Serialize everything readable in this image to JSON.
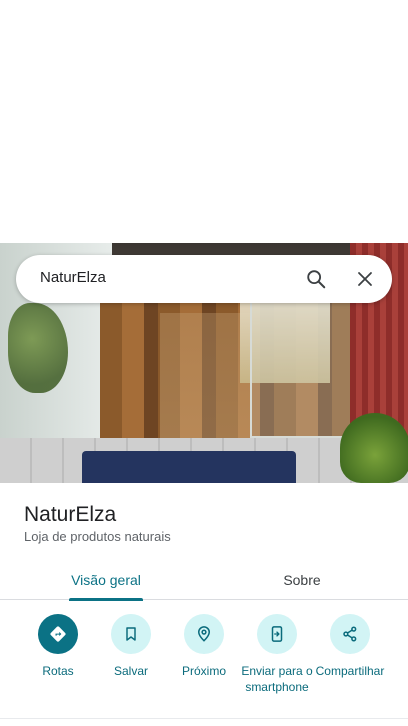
{
  "search": {
    "query": "NaturElza",
    "search_icon": "search-icon",
    "close_icon": "close-icon"
  },
  "place": {
    "name": "NaturElza",
    "category": "Loja de produtos naturais"
  },
  "tabs": [
    {
      "label": "Visão geral",
      "selected": true
    },
    {
      "label": "Sobre",
      "selected": false
    }
  ],
  "actions": [
    {
      "label": "Rotas",
      "icon": "directions-icon"
    },
    {
      "label": "Salvar",
      "icon": "bookmark-icon"
    },
    {
      "label": "Próximo",
      "icon": "nearby-icon"
    },
    {
      "label": "Enviar para o smartphone",
      "icon": "send-to-phone-icon"
    },
    {
      "label": "Compartilhar",
      "icon": "share-icon"
    }
  ],
  "colors": {
    "accent": "#0b7285",
    "action_bg": "#d2f4f5"
  }
}
